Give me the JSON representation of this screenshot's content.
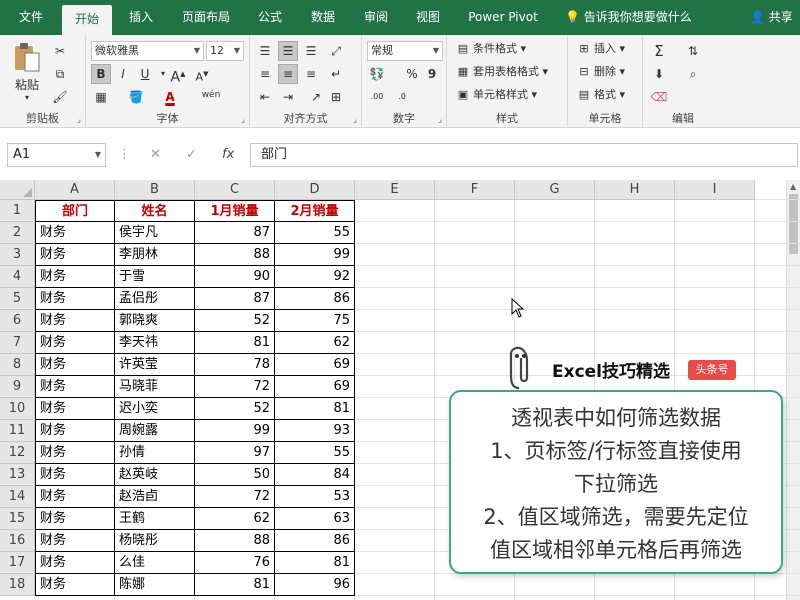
{
  "ribbon_tabs": [
    {
      "label": "文件",
      "active": false
    },
    {
      "label": "开始",
      "active": true
    },
    {
      "label": "插入",
      "active": false
    },
    {
      "label": "页面布局",
      "active": false
    },
    {
      "label": "公式",
      "active": false
    },
    {
      "label": "数据",
      "active": false
    },
    {
      "label": "审阅",
      "active": false
    },
    {
      "label": "视图",
      "active": false
    },
    {
      "label": "Power Pivot",
      "active": false
    }
  ],
  "tell_me": "告诉我你想要做什么",
  "share": "共享",
  "clipboard": {
    "paste": "粘贴",
    "label": "剪贴板"
  },
  "font": {
    "name": "微软雅黑",
    "size": "12",
    "label": "字体",
    "bold": "B",
    "italic": "I",
    "underline": "U",
    "color_a": "A",
    "wen": "wén"
  },
  "alignment": {
    "label": "对齐方式"
  },
  "number": {
    "format": "常规",
    "label": "数字",
    "percent": "%",
    "comma": "9"
  },
  "styles": {
    "conditional": "条件格式",
    "table": "套用表格格式",
    "cell": "单元格样式",
    "label": "样式"
  },
  "cells": {
    "insert": "插入",
    "delete": "删除",
    "format": "格式",
    "label": "单元格"
  },
  "editing": {
    "label": "编辑"
  },
  "name_box": "A1",
  "formula": "部门",
  "columns": [
    "A",
    "B",
    "C",
    "D",
    "E",
    "F",
    "G",
    "H",
    "I"
  ],
  "headers": [
    "部门",
    "姓名",
    "1月销量",
    "2月销量"
  ],
  "rows": [
    [
      "财务",
      "侯宇凡",
      87,
      55
    ],
    [
      "财务",
      "李朋林",
      88,
      99
    ],
    [
      "财务",
      "于雪",
      90,
      92
    ],
    [
      "财务",
      "孟侣彤",
      87,
      86
    ],
    [
      "财务",
      "郭晓爽",
      52,
      75
    ],
    [
      "财务",
      "李天祎",
      81,
      62
    ],
    [
      "财务",
      "许英莹",
      78,
      69
    ],
    [
      "财务",
      "马晓菲",
      72,
      69
    ],
    [
      "财务",
      "迟小奕",
      52,
      81
    ],
    [
      "财务",
      "周婉露",
      99,
      93
    ],
    [
      "财务",
      "孙倩",
      97,
      55
    ],
    [
      "财务",
      "赵英岐",
      50,
      84
    ],
    [
      "财务",
      "赵浩卣",
      72,
      53
    ],
    [
      "财务",
      "王鹤",
      62,
      63
    ],
    [
      "财务",
      "杨晓彤",
      88,
      86
    ],
    [
      "财务",
      "么佳",
      76,
      81
    ],
    [
      "财务",
      "陈娜",
      81,
      96
    ]
  ],
  "brand": {
    "name": "Excel技巧精选",
    "badge": "头条号"
  },
  "card_lines": [
    "透视表中如何筛选数据",
    "1、页标签/行标签直接使用",
    "下拉筛选",
    "2、值区域筛选，需要先定位",
    "值区域相邻单元格后再筛选"
  ],
  "colors": {
    "excel_green": "#217346",
    "header_red": "#c00000",
    "card_border": "#3aa889",
    "badge_red": "#e94b4b"
  }
}
